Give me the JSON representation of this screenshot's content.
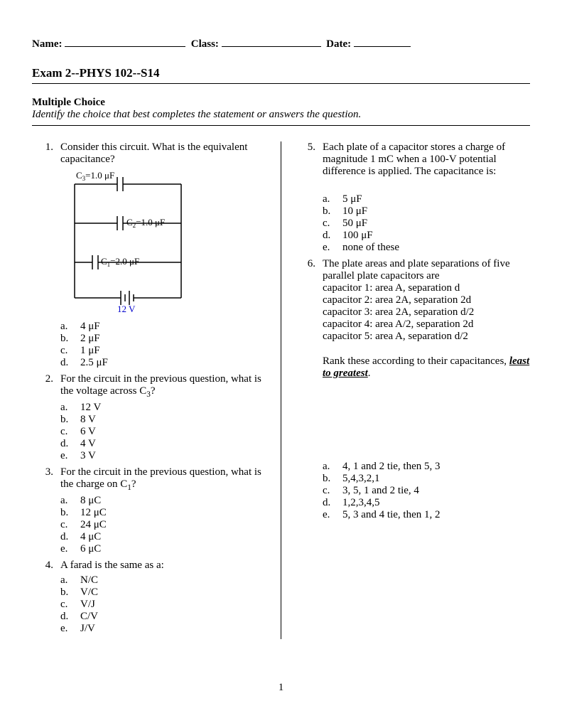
{
  "header": {
    "name_label": "Name:",
    "class_label": "Class:",
    "date_label": "Date:"
  },
  "title": "Exam 2--PHYS 102--S14",
  "section": "Multiple Choice",
  "instructions": "Identify the choice that best completes the statement or answers the question.",
  "q1": {
    "num": "1.",
    "text": "Consider this circuit.  What is the equivalent capacitance?",
    "c3_label": "C",
    "c3_sub": "3",
    "c3_val": "=1.0 μF",
    "c2_label": "C",
    "c2_sub": "2",
    "c2_val": "=1.0 μF",
    "c1_label": "C",
    "c1_sub": "1",
    "c1_val": "=2.0 μF",
    "volt": "12 V",
    "a": "4 μF",
    "b": "2 μF",
    "c": "1 μF",
    "d": "2.5 μF"
  },
  "q2": {
    "num": "2.",
    "text_a": "For the circuit in the previous question, what is the voltage across C",
    "text_sub": "3",
    "text_b": "?",
    "a": "12 V",
    "b": "8 V",
    "c": "6 V",
    "d": "4 V",
    "e": "3 V"
  },
  "q3": {
    "num": "3.",
    "text_a": "For the circuit in the previous question, what is the charge on C",
    "text_sub": "1",
    "text_b": "?",
    "a": "8 μC",
    "b": "12 μC",
    "c": "24 μC",
    "d": "4 μC",
    "e": "6 μC"
  },
  "q4": {
    "num": "4.",
    "text": "A farad is the same as a:",
    "a": "N/C",
    "b": "V/C",
    "c": "V/J",
    "d": "C/V",
    "e": "J/V"
  },
  "q5": {
    "num": "5.",
    "text": "Each plate of a capacitor stores a charge of magnitude 1 mC when a 100-V potential difference is applied. The capacitance is:",
    "a": "5 μF",
    "b": "10 μF",
    "c": "50 μF",
    "d": "100 μF",
    "e": "none of these"
  },
  "q6": {
    "num": "6.",
    "text": "The plate areas and plate separations of five parallel plate capacitors are",
    "cap1": "capacitor 1: area A, separation d",
    "cap2": "capacitor 2: area 2A, separation 2d",
    "cap3": "capacitor 3: area 2A, separation d/2",
    "cap4": "capacitor 4: area A/2, separation 2d",
    "cap5": "capacitor 5: area A, separation d/2",
    "rank_a": "Rank these according to their capacitances, ",
    "rank_em": "least to greatest",
    "rank_b": ".",
    "a": "4, 1 and 2 tie, then 5, 3",
    "b": "5,4,3,2,1",
    "c": "3, 5, 1 and 2 tie, 4",
    "d": "1,2,3,4,5",
    "e": "5, 3 and 4 tie, then 1, 2"
  },
  "labels": {
    "a": "a.",
    "b": "b.",
    "c": "c.",
    "d": "d.",
    "e": "e."
  },
  "page": "1"
}
